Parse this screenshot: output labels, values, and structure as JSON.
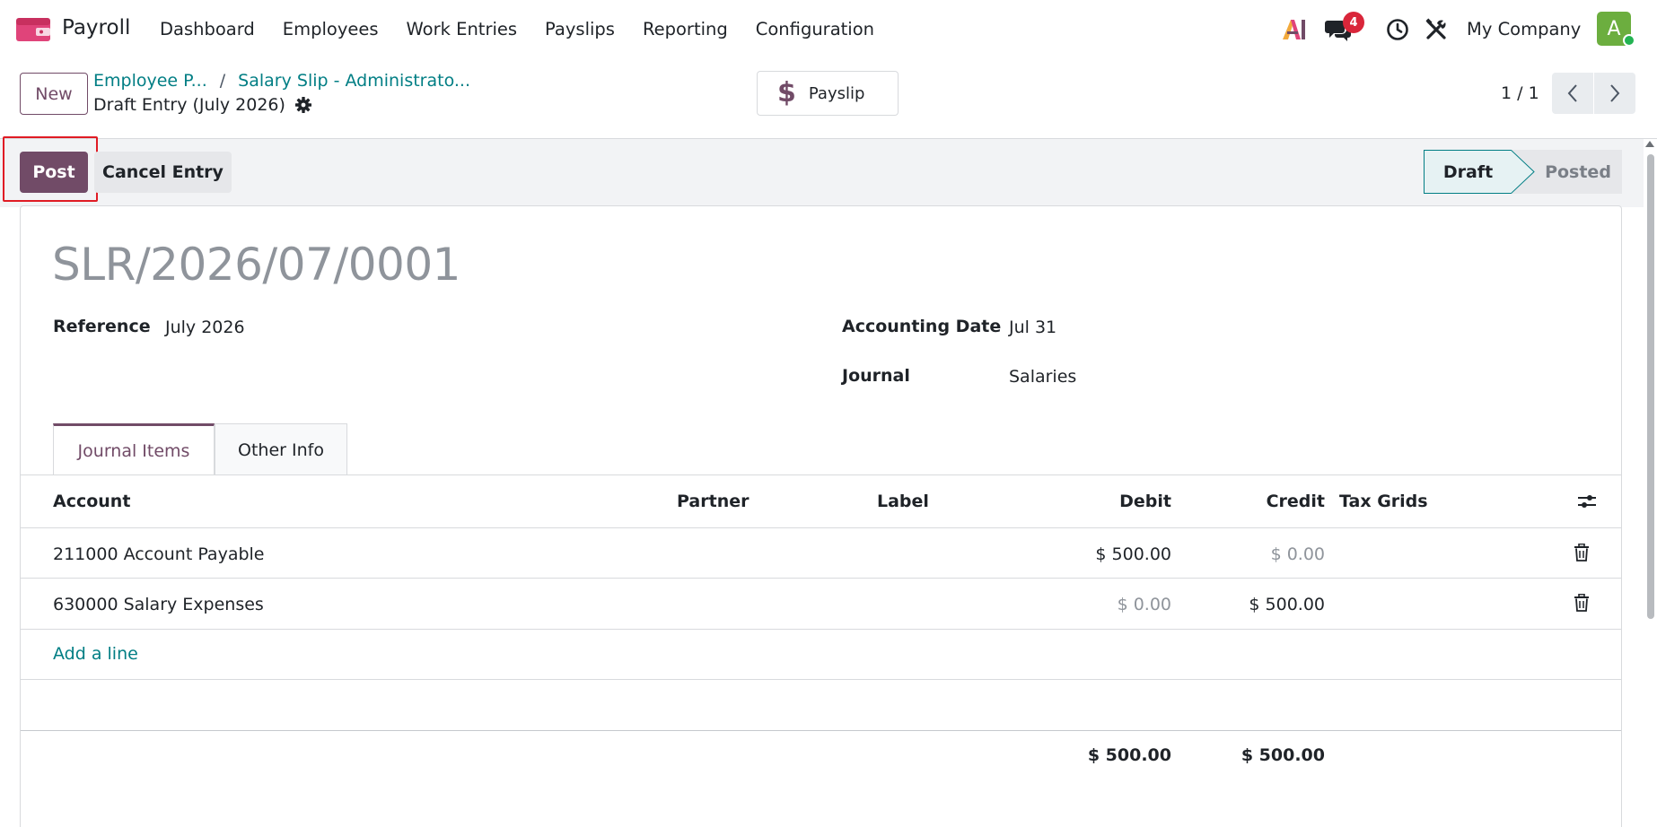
{
  "navbar": {
    "app_name": "Payroll",
    "menu": [
      "Dashboard",
      "Employees",
      "Work Entries",
      "Payslips",
      "Reporting",
      "Configuration"
    ],
    "chat_badge": "4",
    "company": "My Company",
    "avatar_letter": "A",
    "colors": {
      "brand": "#714b67",
      "link": "#017e84",
      "badge": "#d9263a",
      "avatar": "#6cae3f"
    }
  },
  "control": {
    "new_label": "New",
    "breadcrumb": [
      "Employee P...",
      "Salary Slip - Administrato..."
    ],
    "breadcrumb_sep": "/",
    "record_title": "Draft Entry (July 2026)",
    "payslip_label": "Payslip",
    "pager": "1 / 1"
  },
  "statusbar": {
    "post_label": "Post",
    "cancel_label": "Cancel Entry",
    "stages": [
      "Draft",
      "Posted"
    ],
    "current_stage": "Draft"
  },
  "form": {
    "name": "SLR/2026/07/0001",
    "reference_label": "Reference",
    "reference_value": "July 2026",
    "date_label": "Accounting Date",
    "date_value": "Jul 31",
    "journal_label": "Journal",
    "journal_value": "Salaries"
  },
  "tabs": [
    "Journal Items",
    "Other Info"
  ],
  "table": {
    "columns": [
      "Account",
      "Partner",
      "Label",
      "Debit",
      "Credit",
      "Tax Grids"
    ],
    "rows": [
      {
        "account": "211000 Account Payable",
        "partner": "",
        "label": "",
        "debit": "$ 500.00",
        "credit": "$ 0.00"
      },
      {
        "account": "630000 Salary Expenses",
        "partner": "",
        "label": "",
        "debit": "$ 0.00",
        "credit": "$ 500.00"
      }
    ],
    "add_line": "Add a line",
    "total_debit": "$ 500.00",
    "total_credit": "$ 500.00"
  }
}
